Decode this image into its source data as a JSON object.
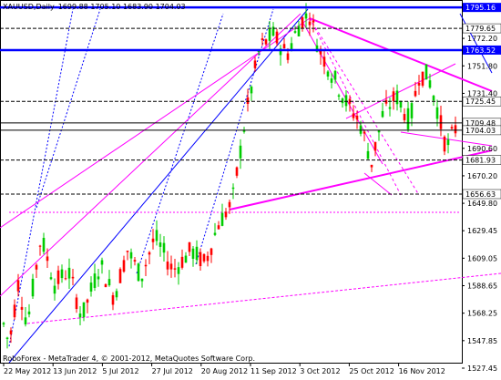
{
  "header": {
    "symbol": "XAUUSD,Daily",
    "ohlc": "1699.88 1705.10 1683.90 1704.03"
  },
  "footer": {
    "watermark": "RoboForex - MetaTrader 4, © 2001-2012, MetaQuotes Software Corp."
  },
  "colors": {
    "up_candle": "#00cc00",
    "down_candle": "#ff0000",
    "trend_blue": "#0000ff",
    "trend_magenta": "#ff00ff",
    "level_line": "#000000",
    "highlight_label_bg": "#0000ff",
    "highlight_label_fg": "#ffffff"
  },
  "chart_data": {
    "type": "candlestick",
    "ylim": [
      1531.5,
      1800
    ],
    "price_levels": [
      {
        "value": 1795.16,
        "label": "1795.16",
        "highlight": true
      },
      {
        "value": 1779.65,
        "label": "1779.65",
        "highlight": false
      },
      {
        "value": 1763.52,
        "label": "1763.52",
        "highlight": true
      },
      {
        "value": 1725.45,
        "label": "1725.45",
        "highlight": false
      },
      {
        "value": 1709.48,
        "label": "1709.48",
        "highlight": false
      },
      {
        "value": 1704.03,
        "label": "1704.03",
        "highlight": false
      },
      {
        "value": 1681.93,
        "label": "1681.93",
        "highlight": false
      },
      {
        "value": 1656.63,
        "label": "1656.63",
        "highlight": false
      }
    ],
    "y_ticks": [
      "1772.20",
      "1751.80",
      "1731.40",
      "1690.60",
      "1670.20",
      "1649.80",
      "1629.45",
      "1609.05",
      "1588.65",
      "1568.25",
      "1547.85",
      "1527.45"
    ],
    "x_ticks": [
      "22 May 2012",
      "13 Jun 2012",
      "5 Jul 2012",
      "27 Jul 2012",
      "20 Aug 2012",
      "11 Sep 2012",
      "3 Oct 2012",
      "25 Oct 2012",
      "16 Nov 2012"
    ]
  }
}
